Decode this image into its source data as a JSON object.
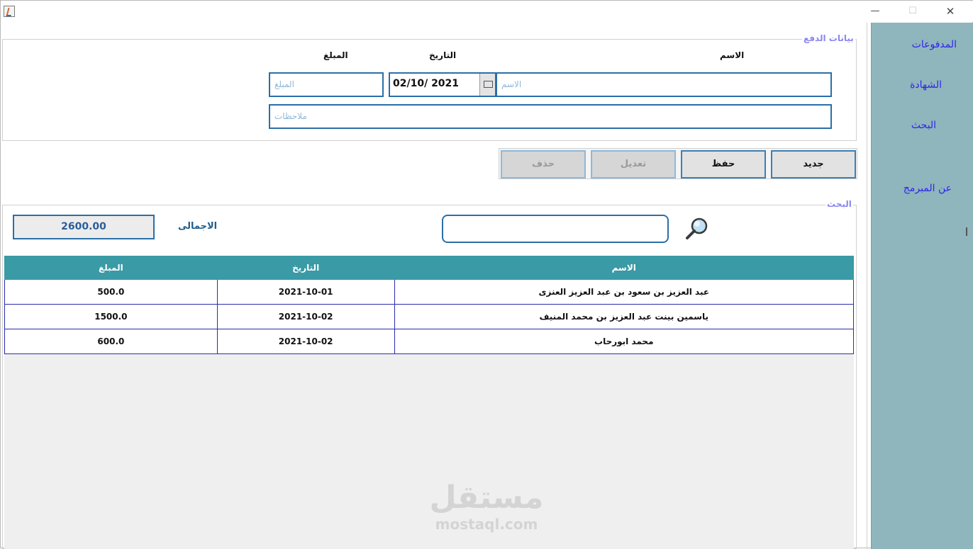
{
  "window": {
    "min_glyph": "—",
    "max_glyph": "☐",
    "close_glyph": "✕"
  },
  "sidebar": {
    "items": [
      {
        "label": "المدفوعات"
      },
      {
        "label": "الشهادة"
      },
      {
        "label": "البحث"
      },
      {
        "label": "عن المبرمج"
      }
    ]
  },
  "payment": {
    "legend": "بيانات الدفع",
    "labels": {
      "name": "الاسم",
      "date": "التاريخ",
      "amount": "المبلغ"
    },
    "name_placeholder": "الاسم",
    "date_value": "02/10/ 2021",
    "amount_placeholder": "المبلغ",
    "notes_placeholder": "ملاحظات"
  },
  "actions": {
    "new_label": "جديد",
    "save_label": "حفظ",
    "edit_label": "تعديل",
    "delete_label": "حذف"
  },
  "search": {
    "legend": "البحث",
    "total_value": "2600.00",
    "total_label": "الاجمالى",
    "query": ""
  },
  "table": {
    "headers": {
      "amount": "المبلغ",
      "date": "التاريخ",
      "name": "الاسم"
    },
    "rows": [
      {
        "amount": "500.0",
        "date": "2021-10-01",
        "name": "عبد العزيز بن سعود بن عبد العزيز العنزى"
      },
      {
        "amount": "1500.0",
        "date": "2021-10-02",
        "name": "ياسمين بينت عبد العزيز بن محمد المنيف"
      },
      {
        "amount": "600.0",
        "date": "2021-10-02",
        "name": "محمد ابورحاب"
      }
    ]
  },
  "watermark": {
    "arabic": "مستقل",
    "latin": "mostaql.com"
  },
  "colors": {
    "sidebar": "#8fb5bd",
    "table_header": "#3a9aa5",
    "field_border": "#2a6fa8",
    "nav_text": "#2e26e8"
  }
}
